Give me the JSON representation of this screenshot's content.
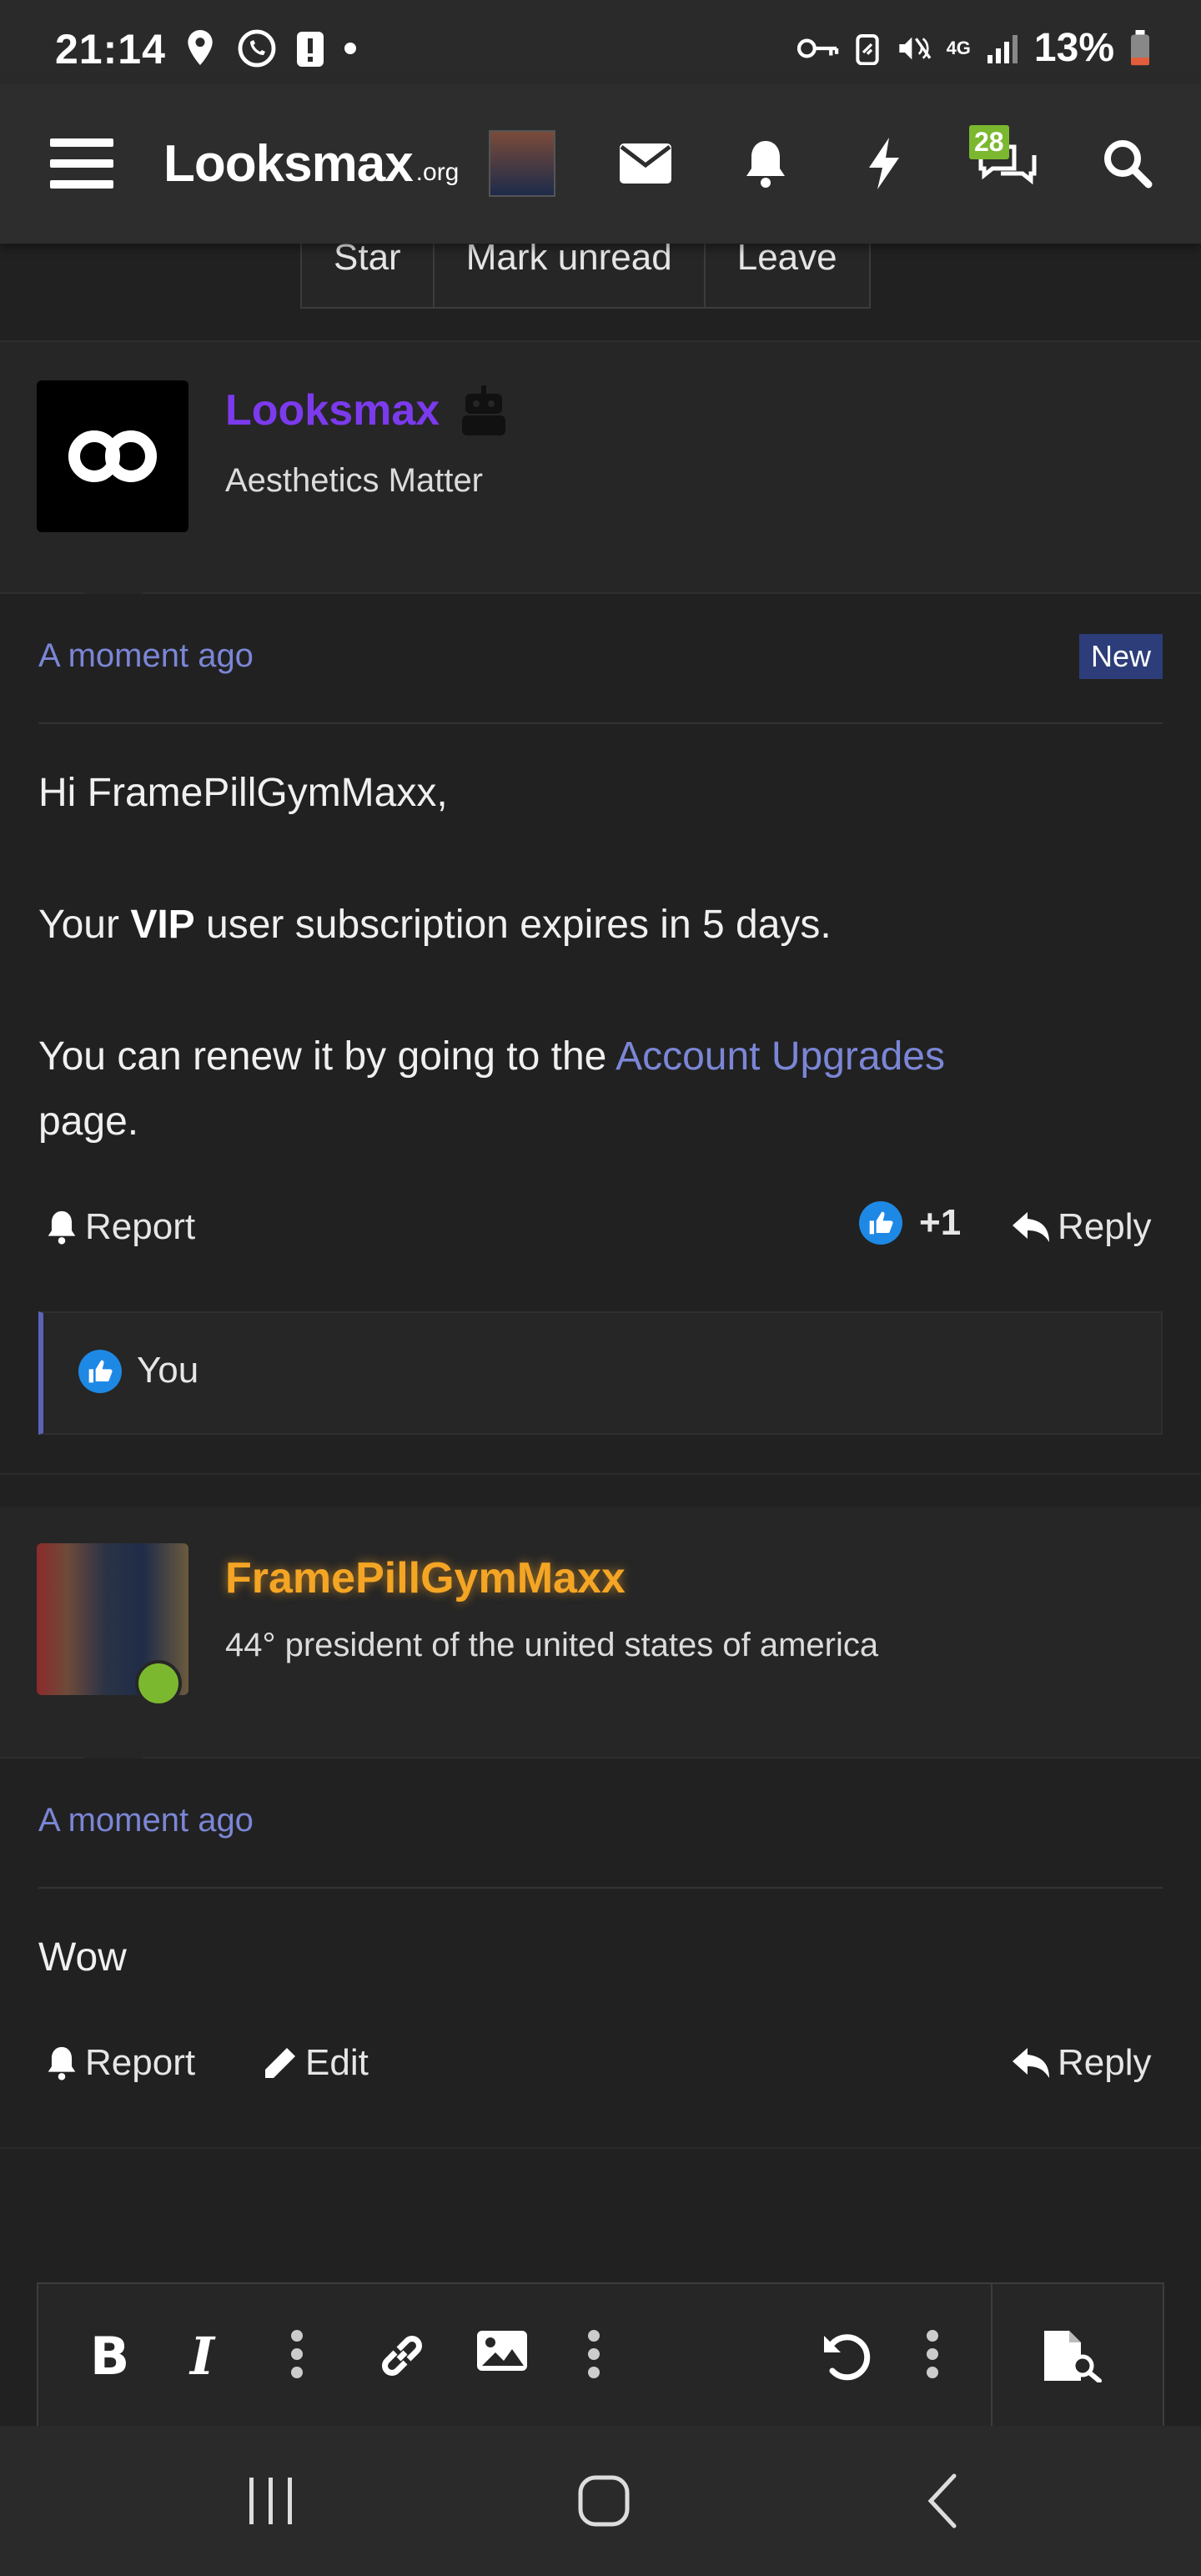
{
  "status_bar": {
    "time": "21:14",
    "network": "4G",
    "battery": "13%"
  },
  "top_nav": {
    "logo": "Looksmax",
    "logo_suffix": ".org",
    "chat_badge": "28"
  },
  "thread_actions": [
    "Star",
    "Mark unread",
    "Leave"
  ],
  "messages": [
    {
      "user": "Looksmax",
      "user_color": "#7c3aed",
      "user_title": "Aesthetics Matter",
      "time": "A moment ago",
      "badge": "New",
      "greeting": "Hi FramePillGymMaxx,",
      "line2_prefix": "Your ",
      "line2_bold": "VIP",
      "line2_suffix": " user subscription expires in 5 days.",
      "line3_prefix": "You can renew it by going to the ",
      "line3_link": "Account Upgrades",
      "line3_suffix": "page.",
      "report": "Report",
      "reaction_count": "+1",
      "reply": "Reply",
      "reacted_by": "You"
    },
    {
      "user": "FramePillGymMaxx",
      "user_color": "#f5a524",
      "user_title": "44° president of the united states of america",
      "time": "A moment ago",
      "text": "Wow",
      "report": "Report",
      "edit": "Edit",
      "reply": "Reply"
    }
  ],
  "colors": {
    "background": "#212121",
    "link": "#7b86d6",
    "online": "#7bb82f"
  }
}
